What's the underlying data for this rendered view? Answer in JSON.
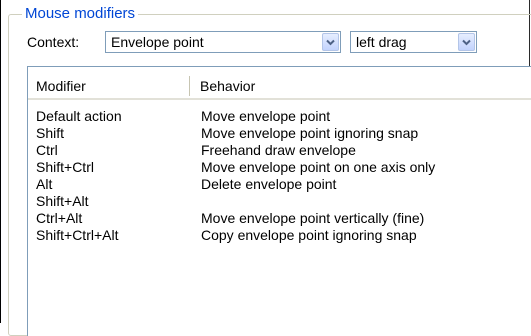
{
  "group": {
    "title": "Mouse modifiers"
  },
  "context": {
    "label": "Context:",
    "selected": "Envelope point",
    "action_selected": "left drag"
  },
  "table": {
    "columns": [
      "Modifier",
      "Behavior"
    ],
    "rows": [
      {
        "modifier": "Default action",
        "behavior": "Move envelope point"
      },
      {
        "modifier": "Shift",
        "behavior": "Move envelope point ignoring snap"
      },
      {
        "modifier": "Ctrl",
        "behavior": "Freehand draw envelope"
      },
      {
        "modifier": "Shift+Ctrl",
        "behavior": "Move envelope point on one axis only"
      },
      {
        "modifier": "Alt",
        "behavior": "Delete envelope point"
      },
      {
        "modifier": "Shift+Alt",
        "behavior": ""
      },
      {
        "modifier": "Ctrl+Alt",
        "behavior": "Move envelope point vertically (fine)"
      },
      {
        "modifier": "Shift+Ctrl+Alt",
        "behavior": "Copy envelope point ignoring snap"
      }
    ]
  },
  "icons": {
    "dropdown": "chevron-down-icon"
  },
  "colors": {
    "group_title": "#0046d5",
    "border": "#7f9db9",
    "background": "#ffffff"
  }
}
